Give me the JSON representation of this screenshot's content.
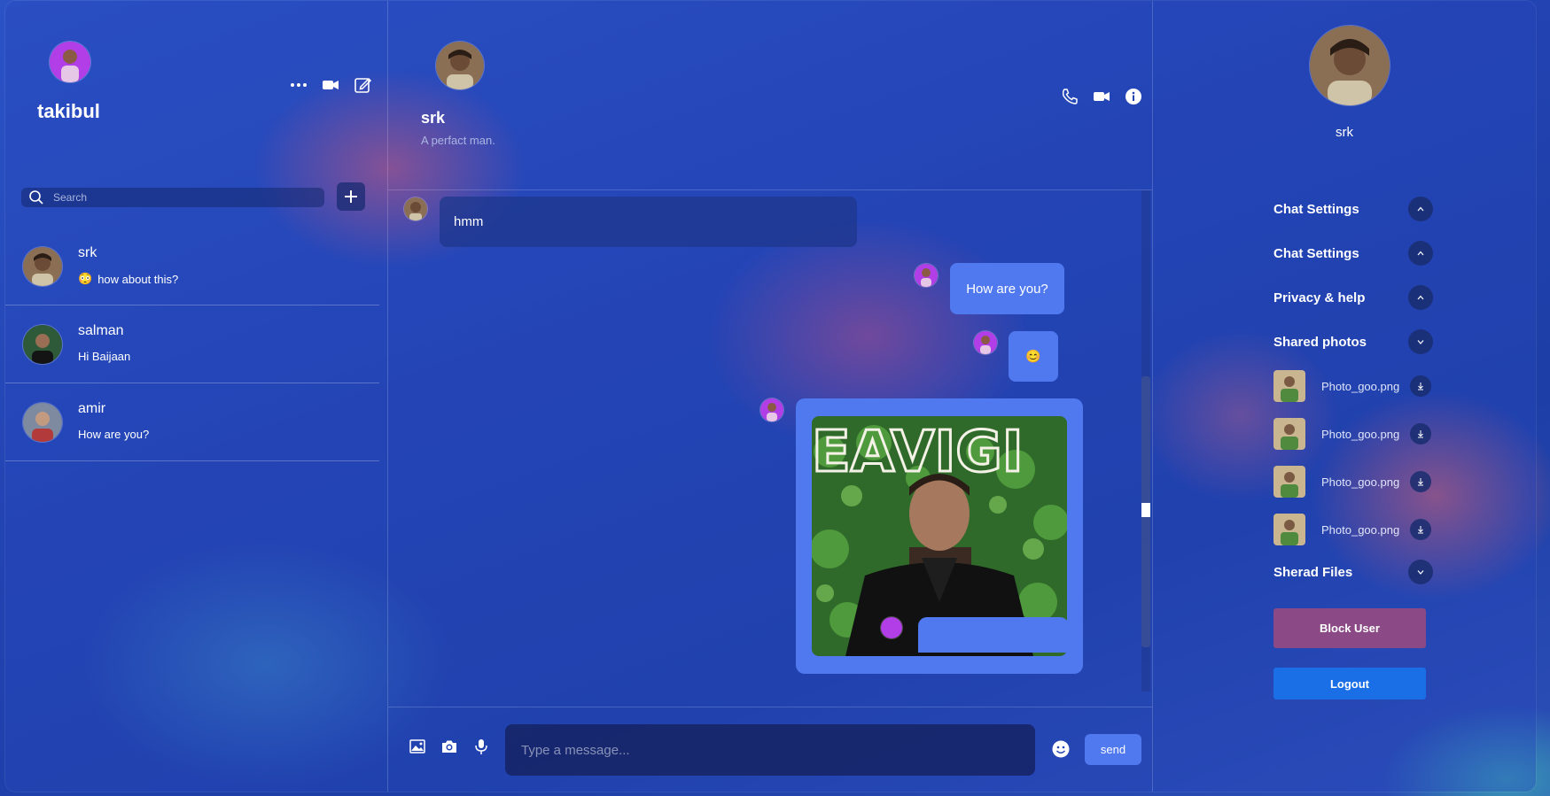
{
  "colors": {
    "accent": "#5079f0",
    "block_button": "#8b4a86",
    "logout_button": "#1a6fe6"
  },
  "sidebar": {
    "user_name": "takibul",
    "icons": [
      "more-options-icon",
      "video-call-icon",
      "new-chat-icon"
    ],
    "search": {
      "placeholder": "Search",
      "value": ""
    },
    "add_icon": "plus-icon",
    "chats": [
      {
        "name": "srk",
        "preview": "how about this?",
        "preview_emoji": "😳"
      },
      {
        "name": "salman",
        "preview": "Hi Baijaan"
      },
      {
        "name": "amir",
        "preview": "How are you?"
      }
    ]
  },
  "chat": {
    "contact_name": "srk",
    "status": "A perfact man.",
    "icons": [
      "phone-icon",
      "video-call-icon",
      "info-icon"
    ],
    "messages": [
      {
        "from": "contact",
        "text": "hmm"
      },
      {
        "from": "me",
        "text": "How are you?"
      },
      {
        "from": "me",
        "text": "😊"
      },
      {
        "from": "me",
        "type": "image"
      }
    ],
    "composer": {
      "icons": [
        "image-icon",
        "camera-icon",
        "microphone-icon"
      ],
      "placeholder": "Type a message...",
      "emoji_icon": "emoji-icon",
      "send_label": "send"
    }
  },
  "details": {
    "contact_name": "srk",
    "sections": [
      {
        "title": "Chat Settings",
        "state": "collapsed"
      },
      {
        "title": "Chat Settings",
        "state": "collapsed"
      },
      {
        "title": "Privacy & help",
        "state": "collapsed"
      },
      {
        "title": "Shared photos",
        "state": "expanded"
      }
    ],
    "photos": [
      {
        "name": "Photo_goo.png"
      },
      {
        "name": "Photo_goo.png"
      },
      {
        "name": "Photo_goo.png"
      },
      {
        "name": "Photo_goo.png"
      }
    ],
    "files_section": {
      "title": "Sherad Files",
      "state": "expanded"
    },
    "block_label": "Block User",
    "logout_label": "Logout"
  }
}
